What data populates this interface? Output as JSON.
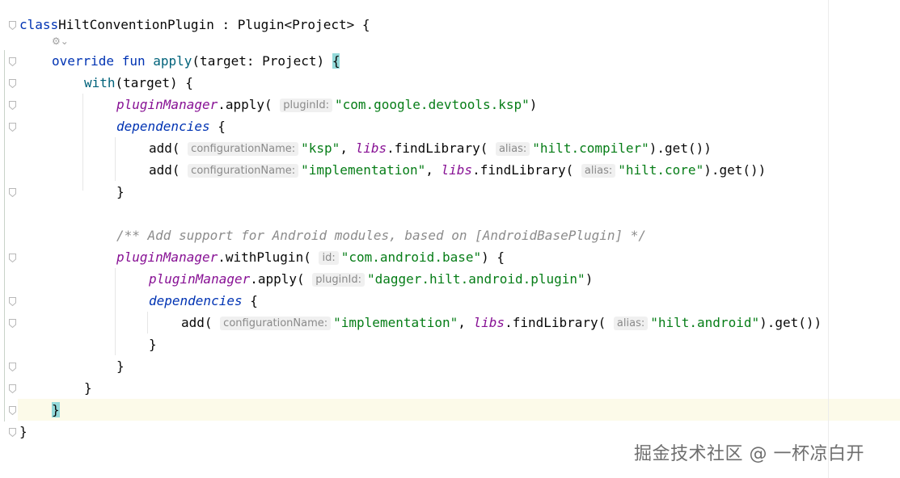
{
  "editor": {
    "lines": [
      {
        "tokens": [
          [
            "kw",
            "class"
          ],
          [
            "",
            "HiltConventionPlugin : Plugin<Project> {"
          ]
        ]
      },
      {
        "tokens": [
          [
            "kw",
            "override"
          ],
          [
            "",
            " "
          ],
          [
            "kw",
            "fun"
          ],
          [
            "",
            " "
          ],
          [
            "fn",
            "apply"
          ],
          [
            "",
            "(target: Project) "
          ],
          [
            "brace",
            "{"
          ]
        ]
      },
      {
        "tokens": [
          [
            "fn",
            "with"
          ],
          [
            "",
            "(target) {"
          ]
        ]
      },
      {
        "tokens": [
          [
            "prop",
            "pluginManager"
          ],
          [
            "",
            ".apply( "
          ],
          [
            "hint",
            "pluginId:"
          ],
          [
            "str",
            "\"com.google.devtools.ksp\""
          ],
          [
            "",
            ")"
          ]
        ]
      },
      {
        "tokens": [
          [
            "ext",
            "dependencies"
          ],
          [
            "",
            " {"
          ]
        ]
      },
      {
        "tokens": [
          [
            "",
            "add( "
          ],
          [
            "hint",
            "configurationName:"
          ],
          [
            "str",
            "\"ksp\""
          ],
          [
            "",
            ", "
          ],
          [
            "prop",
            "libs"
          ],
          [
            "",
            ".findLibrary( "
          ],
          [
            "hint",
            "alias:"
          ],
          [
            "str",
            "\"hilt.compiler\""
          ],
          [
            "",
            ").get())"
          ]
        ]
      },
      {
        "tokens": [
          [
            "",
            "add( "
          ],
          [
            "hint",
            "configurationName:"
          ],
          [
            "str",
            "\"implementation\""
          ],
          [
            "",
            ", "
          ],
          [
            "prop",
            "libs"
          ],
          [
            "",
            ".findLibrary( "
          ],
          [
            "hint",
            "alias:"
          ],
          [
            "str",
            "\"hilt.core\""
          ],
          [
            "",
            ").get())"
          ]
        ]
      },
      {
        "tokens": [
          [
            "",
            "}"
          ]
        ]
      },
      {
        "tokens": [
          [
            "cmt",
            "/** Add support for Android modules, based on [AndroidBasePlugin] */"
          ]
        ]
      },
      {
        "tokens": [
          [
            "prop",
            "pluginManager"
          ],
          [
            "",
            ".withPlugin( "
          ],
          [
            "hint",
            "id:"
          ],
          [
            "str",
            "\"com.android.base\""
          ],
          [
            "",
            ") {"
          ]
        ]
      },
      {
        "tokens": [
          [
            "prop",
            "pluginManager"
          ],
          [
            "",
            ".apply( "
          ],
          [
            "hint",
            "pluginId:"
          ],
          [
            "str",
            "\"dagger.hilt.android.plugin\""
          ],
          [
            "",
            ")"
          ]
        ]
      },
      {
        "tokens": [
          [
            "ext",
            "dependencies"
          ],
          [
            "",
            " {"
          ]
        ]
      },
      {
        "tokens": [
          [
            "",
            "add( "
          ],
          [
            "hint",
            "configurationName:"
          ],
          [
            "str",
            "\"implementation\""
          ],
          [
            "",
            ", "
          ],
          [
            "prop",
            "libs"
          ],
          [
            "",
            ".findLibrary( "
          ],
          [
            "hint",
            "alias:"
          ],
          [
            "str",
            "\"hilt.android\""
          ],
          [
            "",
            ").get())"
          ]
        ]
      },
      {
        "tokens": [
          [
            "",
            "}"
          ]
        ]
      },
      {
        "tokens": [
          [
            "",
            "}"
          ]
        ]
      },
      {
        "tokens": [
          [
            "",
            "}"
          ]
        ]
      },
      {
        "tokens": [
          [
            "brace",
            "}"
          ]
        ]
      },
      {
        "tokens": [
          [
            "",
            "}"
          ]
        ]
      }
    ]
  },
  "watermark": "掘金技术社区 @ 一杯凉白开",
  "colors": {
    "keyword": "#0033b3",
    "string": "#067d17",
    "property": "#871094",
    "comment": "#8c8c8c",
    "brace_highlight": "#93d9d9",
    "caret_line": "#fcfae9"
  },
  "icons": [
    "fold-marker-icon",
    "ai-assistant-icon",
    "chevron-down-icon"
  ]
}
